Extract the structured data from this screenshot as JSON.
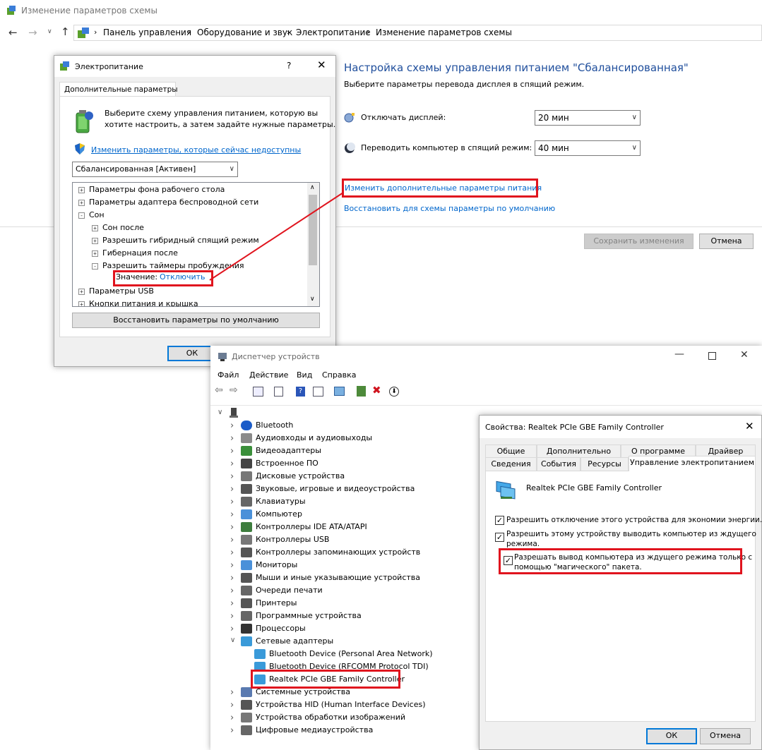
{
  "main_window": {
    "title": "Изменение параметров схемы",
    "breadcrumb": [
      "Панель управления",
      "Оборудование и звук",
      "Электропитание",
      "Изменение параметров схемы"
    ],
    "heading": "Настройка схемы управления питанием \"Сбалансированная\"",
    "subheading": "Выберите параметры перевода дисплея в спящий режим.",
    "display_off_label": "Отключать дисплей:",
    "display_off_value": "20 мин",
    "sleep_label": "Переводить компьютер в спящий режим:",
    "sleep_value": "40 мин",
    "advanced_link": "Изменить дополнительные параметры питания",
    "restore_link": "Восстановить для схемы параметры по умолчанию",
    "save_button": "Сохранить изменения",
    "cancel_button": "Отмена"
  },
  "power_dialog": {
    "title": "Электропитание",
    "help": "?",
    "tab": "Дополнительные параметры",
    "description": [
      "Выберите схему управления питанием, которую вы",
      "хотите настроить, а затем задайте нужные параметры."
    ],
    "unavailable_link": "Изменить параметры, которые сейчас недоступны",
    "scheme_value": "Сбалансированная [Активен]",
    "tree": [
      {
        "label": "Параметры фона рабочего стола",
        "sign": "+",
        "level": 0
      },
      {
        "label": "Параметры адаптера беспроводной сети",
        "sign": "+",
        "level": 0
      },
      {
        "label": "Сон",
        "sign": "−",
        "level": 0
      },
      {
        "label": "Сон после",
        "sign": "+",
        "level": 1
      },
      {
        "label": "Разрешить гибридный спящий режим",
        "sign": "+",
        "level": 1
      },
      {
        "label": "Гибернация после",
        "sign": "+",
        "level": 1
      },
      {
        "label": "Разрешить таймеры пробуждения",
        "sign": "−",
        "level": 1
      },
      {
        "label": "",
        "sign": "",
        "level": 2
      },
      {
        "label": "Параметры USB",
        "sign": "+",
        "level": 0
      },
      {
        "label": "Кнопки питания и крышка",
        "sign": "+",
        "level": 0
      }
    ],
    "value_label": "Значение:",
    "value_link": "Отключить",
    "restore_defaults_button": "Восстановить параметры по умолчанию",
    "ok_button": "ОК"
  },
  "device_manager": {
    "title": "Диспетчер устройств",
    "menu": [
      "Файл",
      "Действие",
      "Вид",
      "Справка"
    ],
    "devices": [
      {
        "label": "Bluetooth",
        "expanded": false,
        "child": false
      },
      {
        "label": "Аудиовходы и аудиовыходы",
        "expanded": false,
        "child": false
      },
      {
        "label": "Видеоадаптеры",
        "expanded": false,
        "child": false
      },
      {
        "label": "Встроенное ПО",
        "expanded": false,
        "child": false
      },
      {
        "label": "Дисковые устройства",
        "expanded": false,
        "child": false
      },
      {
        "label": "Звуковые, игровые и видеоустройства",
        "expanded": false,
        "child": false
      },
      {
        "label": "Клавиатуры",
        "expanded": false,
        "child": false
      },
      {
        "label": "Компьютер",
        "expanded": false,
        "child": false
      },
      {
        "label": "Контроллеры IDE ATA/ATAPI",
        "expanded": false,
        "child": false
      },
      {
        "label": "Контроллеры USB",
        "expanded": false,
        "child": false
      },
      {
        "label": "Контроллеры запоминающих устройств",
        "expanded": false,
        "child": false
      },
      {
        "label": "Мониторы",
        "expanded": false,
        "child": false
      },
      {
        "label": "Мыши и иные указывающие устройства",
        "expanded": false,
        "child": false
      },
      {
        "label": "Очереди печати",
        "expanded": false,
        "child": false
      },
      {
        "label": "Принтеры",
        "expanded": false,
        "child": false
      },
      {
        "label": "Программные устройства",
        "expanded": false,
        "child": false
      },
      {
        "label": "Процессоры",
        "expanded": false,
        "child": false
      },
      {
        "label": "Сетевые адаптеры",
        "expanded": true,
        "child": false
      },
      {
        "label": "Bluetooth Device (Personal Area Network)",
        "expanded": false,
        "child": true
      },
      {
        "label": "Bluetooth Device (RFCOMM Protocol TDI)",
        "expanded": false,
        "child": true
      },
      {
        "label": "Realtek PCIe GBE Family Controller",
        "expanded": false,
        "child": true
      },
      {
        "label": "Системные устройства",
        "expanded": false,
        "child": false
      },
      {
        "label": "Устройства HID (Human Interface Devices)",
        "expanded": false,
        "child": false
      },
      {
        "label": "Устройства обработки изображений",
        "expanded": false,
        "child": false
      },
      {
        "label": "Цифровые медиаустройства",
        "expanded": false,
        "child": false
      }
    ]
  },
  "properties_dialog": {
    "title": "Свойства: Realtek PCIe GBE Family Controller",
    "tabs_row1": [
      "Общие",
      "Дополнительно",
      "О программе",
      "Драйвер"
    ],
    "tabs_row2": [
      "Сведения",
      "События",
      "Ресурсы",
      "Управление электропитанием"
    ],
    "device_name": "Realtek PCIe GBE Family Controller",
    "option1": "Разрешить отключение этого устройства для экономии энергии.",
    "option2_line1": "Разрешить этому устройству выводить компьютер из ждущего",
    "option2_line2": "режима.",
    "option3_line1": "Разрешать вывод компьютера из ждущего режима только с",
    "option3_line2": "помощью \"магического\" пакета.",
    "ok_button": "ОК",
    "cancel_button": "Отмена"
  },
  "colors": {
    "annotation": "#e0141e",
    "link": "#0066cc",
    "heading": "#1f4e9c"
  }
}
